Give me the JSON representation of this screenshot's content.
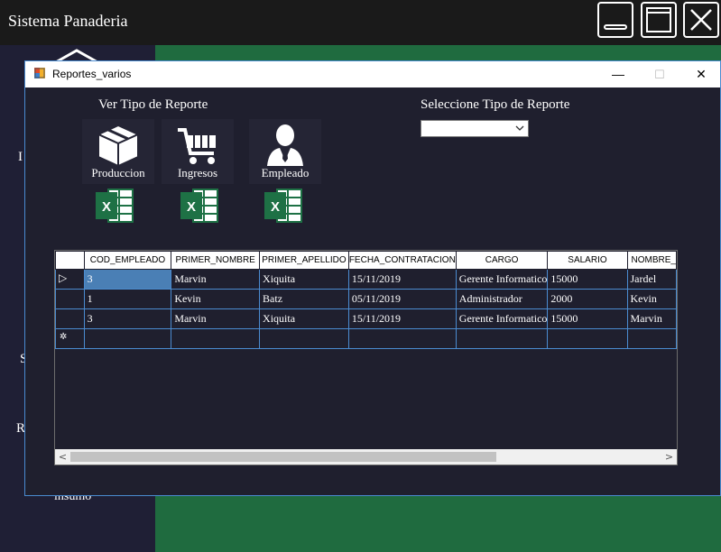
{
  "app": {
    "title": "Sistema Panaderia"
  },
  "sidebar": {
    "partial_items": [
      "I",
      "S",
      "R",
      "insumo"
    ]
  },
  "dialog": {
    "title": "Reportes_varios",
    "controls": {
      "minimize": "—",
      "maximize": "☐",
      "close": "✕"
    },
    "ver_tipo_label": "Ver Tipo de Reporte",
    "seleccione_label": "Seleccione Tipo de Reporte",
    "combo_value": "",
    "report_buttons": [
      {
        "label": "Produccion",
        "icon": "box-icon"
      },
      {
        "label": "Ingresos",
        "icon": "cart-icon"
      },
      {
        "label": "Empleado",
        "icon": "employee-icon"
      }
    ],
    "excel_icons": [
      "excel-icon",
      "excel-icon",
      "excel-icon"
    ]
  },
  "grid": {
    "columns": [
      "COD_EMPLEADO",
      "PRIMER_NOMBRE",
      "PRIMER_APELLIDO",
      "FECHA_CONTRATACION",
      "CARGO",
      "SALARIO",
      "NOMBRE_"
    ],
    "rows": [
      [
        "3",
        "Marvin",
        "Xiquita",
        "15/11/2019",
        "Gerente Informatico",
        "15000",
        "Jardel"
      ],
      [
        "1",
        "Kevin",
        "Batz",
        "05/11/2019",
        "Administrador",
        "2000",
        "Kevin"
      ],
      [
        "3",
        "Marvin",
        "Xiquita",
        "15/11/2019",
        "Gerente Informatico",
        "15000",
        "Marvin"
      ]
    ],
    "current_row_marker": "▷",
    "new_row_marker": "✲",
    "scroll_left": "<",
    "scroll_right": ">"
  },
  "colors": {
    "accent": "#4a8bd0",
    "selection": "#4a7fb5",
    "background": "#1f1f2e",
    "content_green": "#1f6b3f"
  }
}
